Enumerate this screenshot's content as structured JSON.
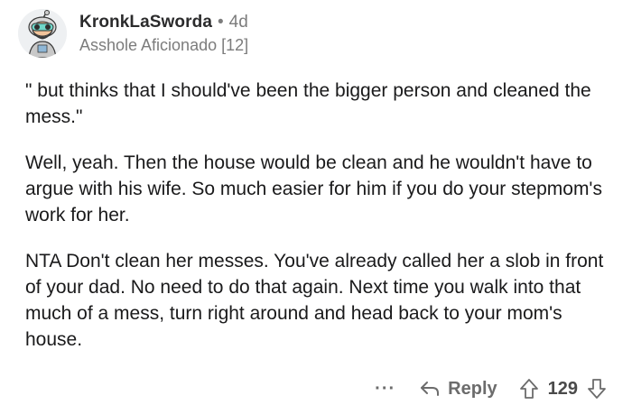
{
  "comment": {
    "username": "KronkLaSworda",
    "separator": "•",
    "age": "4d",
    "flair": "Asshole Aficionado [12]",
    "paragraphs": [
      "\" but thinks that I should've been the bigger person and cleaned the mess.\"",
      "Well, yeah.  Then the house would be clean and he wouldn't have to argue with his wife.  So much easier for him if you do your stepmom's work for her.",
      "NTA  Don't clean her messes.  You've already called her a slob in front of your dad.  No need to do that again. Next time you walk into that much of a mess, turn right around and head back to your mom's house."
    ],
    "footer": {
      "more_label": "···",
      "reply_label": "Reply",
      "score": "129"
    }
  },
  "icons": {
    "avatar": "snoo-avatar-icon",
    "reply": "reply-arrow-icon",
    "upvote": "upvote-arrow-icon",
    "downvote": "downvote-arrow-icon"
  }
}
